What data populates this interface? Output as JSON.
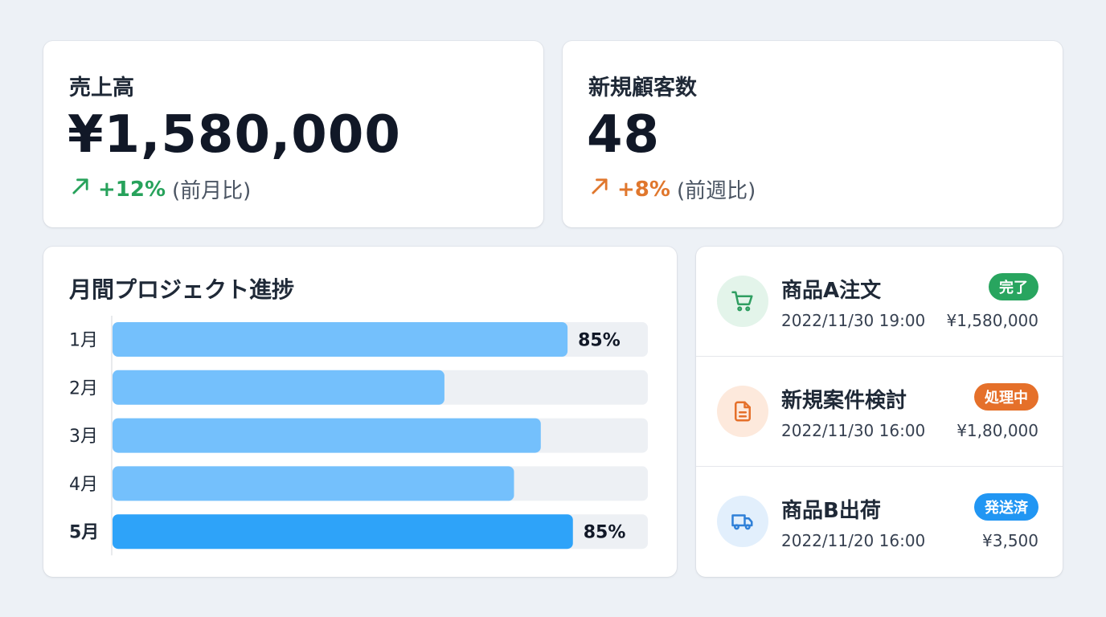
{
  "kpis": {
    "sales": {
      "label": "売上高",
      "value": "¥1,580,000",
      "trend": "+12%",
      "trend_note": "(前月比)",
      "trend_color": "#27a25b",
      "trend_icon": "arrow-up-right-icon"
    },
    "customers": {
      "label": "新規顧客数",
      "value": "48",
      "trend": "+8%",
      "trend_note": "(前週比)",
      "trend_color": "#e0772d",
      "trend_icon": "arrow-up-right-icon"
    }
  },
  "chart_data": {
    "type": "bar",
    "orientation": "horizontal",
    "title": "月間プロジェクト進捗",
    "categories": [
      "1月",
      "2月",
      "3月",
      "4月",
      "5月"
    ],
    "values": [
      85,
      62,
      80,
      75,
      86
    ],
    "value_labels": [
      "85%",
      "",
      "",
      "",
      "85%"
    ],
    "highlight_index": 4,
    "xlim": [
      0,
      100
    ],
    "colors": {
      "bar": "#74c0fc",
      "bar_highlight": "#2ea3f9",
      "track": "#edf0f4"
    }
  },
  "activity": [
    {
      "title": "商品A注文",
      "date": "2022/11/30 19:00",
      "amount": "¥1,580,000",
      "status": "完了",
      "status_color": "#28a55f",
      "icon": "shopping-cart-icon",
      "icon_color": "#2f9e61",
      "icon_bg": "#e3f4ea"
    },
    {
      "title": "新規案件検討",
      "date": "2022/11/30 16:00",
      "amount": "¥1,80,000",
      "status": "処理中",
      "status_color": "#e5702a",
      "icon": "document-icon",
      "icon_color": "#e5702a",
      "icon_bg": "#fde9dc"
    },
    {
      "title": "商品B出荷",
      "date": "2022/11/20 16:00",
      "amount": "¥3,500",
      "status": "発送済",
      "status_color": "#2196f3",
      "icon": "truck-icon",
      "icon_color": "#2f80d8",
      "icon_bg": "#e2effc"
    }
  ]
}
